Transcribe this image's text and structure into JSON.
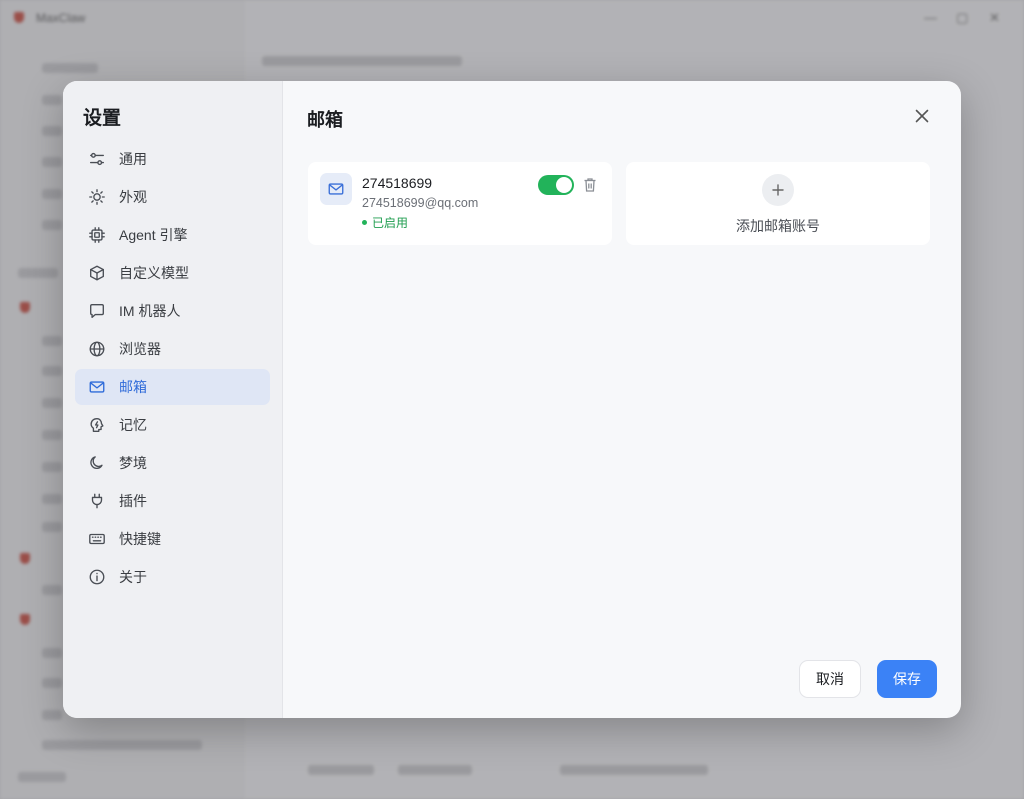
{
  "colors": {
    "accent": "#3b82f6",
    "active_nav_bg": "#dfe6f5",
    "active_nav_text": "#2f6bd9",
    "toggle_on": "#22b35a",
    "status_green": "#1f9d4f"
  },
  "background_app": {
    "title": "MaxClaw"
  },
  "settings": {
    "title": "设置",
    "nav": [
      {
        "label": "通用",
        "icon": "sliders-icon"
      },
      {
        "label": "外观",
        "icon": "sun-icon"
      },
      {
        "label": "Agent 引擎",
        "icon": "cpu-icon"
      },
      {
        "label": "自定义模型",
        "icon": "cube-icon"
      },
      {
        "label": "IM 机器人",
        "icon": "chat-bubble-icon"
      },
      {
        "label": "浏览器",
        "icon": "globe-icon"
      },
      {
        "label": "邮箱",
        "icon": "mail-icon",
        "active": true
      },
      {
        "label": "记忆",
        "icon": "brain-icon"
      },
      {
        "label": "梦境",
        "icon": "moon-icon"
      },
      {
        "label": "插件",
        "icon": "plug-icon"
      },
      {
        "label": "快捷键",
        "icon": "keyboard-icon"
      },
      {
        "label": "关于",
        "icon": "info-icon"
      }
    ]
  },
  "mailbox": {
    "title": "邮箱",
    "accounts": [
      {
        "name": "274518699",
        "email": "274518699@qq.com",
        "status": "已启用",
        "enabled": true
      }
    ],
    "add_label": "添加邮箱账号"
  },
  "footer": {
    "cancel_label": "取消",
    "save_label": "保存"
  }
}
